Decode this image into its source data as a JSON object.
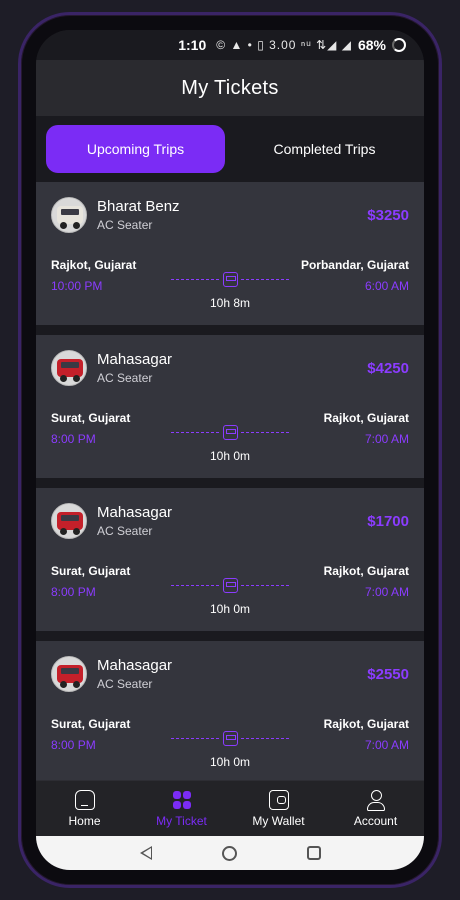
{
  "status": {
    "time": "1:10",
    "icons": "© ▲ • ▯ 3.00 ⁿᵘ ⇅◢ ◢",
    "battery": "68%"
  },
  "appbar": {
    "title": "My Tickets"
  },
  "tabs": [
    {
      "label": "Upcoming Trips",
      "active": true
    },
    {
      "label": "Completed Trips",
      "active": false
    }
  ],
  "tickets": [
    {
      "bus": "Bharat Benz",
      "type": "AC Seater",
      "price": "$3250",
      "from": "Rajkot, Gujarat",
      "from_time": "10:00 PM",
      "to": "Porbandar, Gujarat",
      "to_time": "6:00 AM",
      "duration": "10h 8m"
    },
    {
      "bus": "Mahasagar",
      "type": "AC Seater",
      "price": "$4250",
      "from": "Surat, Gujarat",
      "from_time": "8:00 PM",
      "to": "Rajkot, Gujarat",
      "to_time": "7:00 AM",
      "duration": "10h 0m"
    },
    {
      "bus": "Mahasagar",
      "type": "AC Seater",
      "price": "$1700",
      "from": "Surat, Gujarat",
      "from_time": "8:00 PM",
      "to": "Rajkot, Gujarat",
      "to_time": "7:00 AM",
      "duration": "10h 0m"
    },
    {
      "bus": "Mahasagar",
      "type": "AC Seater",
      "price": "$2550",
      "from": "Surat, Gujarat",
      "from_time": "8:00 PM",
      "to": "Rajkot, Gujarat",
      "to_time": "7:00 AM",
      "duration": "10h 0m"
    }
  ],
  "nav": [
    {
      "label": "Home",
      "icon": "home-icon",
      "active": false
    },
    {
      "label": "My Ticket",
      "icon": "ticket-icon",
      "active": true
    },
    {
      "label": "My Wallet",
      "icon": "wallet-icon",
      "active": false
    },
    {
      "label": "Account",
      "icon": "account-icon",
      "active": false
    }
  ],
  "colors": {
    "accent": "#7b2cf5",
    "price": "#8b3cff",
    "card": "#34353d",
    "background": "#1a1a1f"
  }
}
